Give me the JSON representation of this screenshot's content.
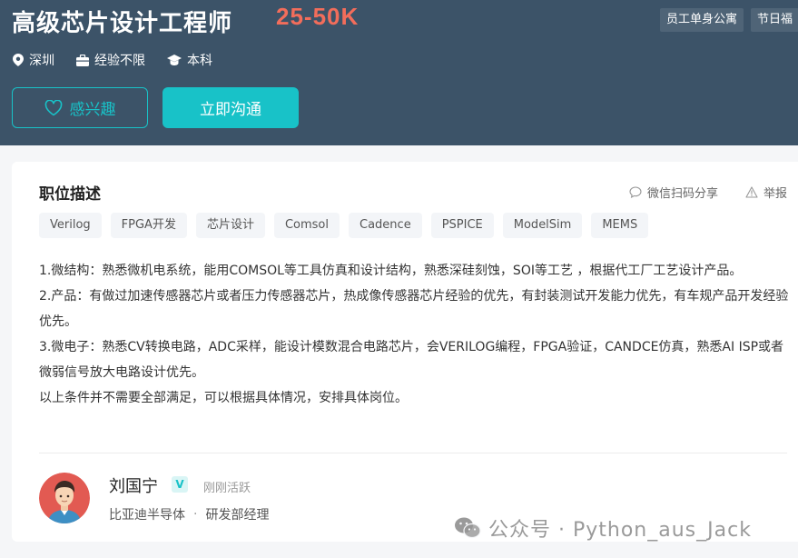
{
  "job": {
    "title": "高级芯片设计工程师",
    "salary": "25-50K",
    "benefits": [
      "员工单身公寓",
      "节日福"
    ],
    "meta": {
      "location": "深圳",
      "experience": "经验不限",
      "education": "本科"
    },
    "buttons": {
      "interest": "感兴趣",
      "chat": "立即沟通"
    }
  },
  "description": {
    "title": "职位描述",
    "share_label": "微信扫码分享",
    "report_label": "举报",
    "tags": [
      "Verilog",
      "FPGA开发",
      "芯片设计",
      "Comsol",
      "Cadence",
      "PSPICE",
      "ModelSim",
      "MEMS"
    ],
    "lines": [
      "1.微结构：熟悉微机电系统，能用COMSOL等工具仿真和设计结构，熟悉深硅刻蚀，SOI等工艺 ，根据代工厂工艺设计产品。",
      "2.产品：有做过加速传感器芯片或者压力传感器芯片，热成像传感器芯片经验的优先，有封装测试开发能力优先，有车规产品开发经验优先。",
      "3.微电子：熟悉CV转换电路，ADC采样，能设计模数混合电路芯片，会VERILOG编程，FPGA验证，CANDCE仿真，熟悉AI ISP或者微弱信号放大电路设计优先。",
      "以上条件并不需要全部满足，可以根据具体情况，安排具体岗位。"
    ]
  },
  "recruiter": {
    "name": "刘国宁",
    "verified_badge": "V",
    "status": "刚刚活跃",
    "company": "比亚迪半导体",
    "separator": "·",
    "position": "研发部经理"
  },
  "watermark": {
    "text": "公众号 · Python_aus_Jack"
  },
  "colors": {
    "header_bg": "#3c5368",
    "accent": "#18c2c8",
    "salary": "#f26d5b"
  }
}
